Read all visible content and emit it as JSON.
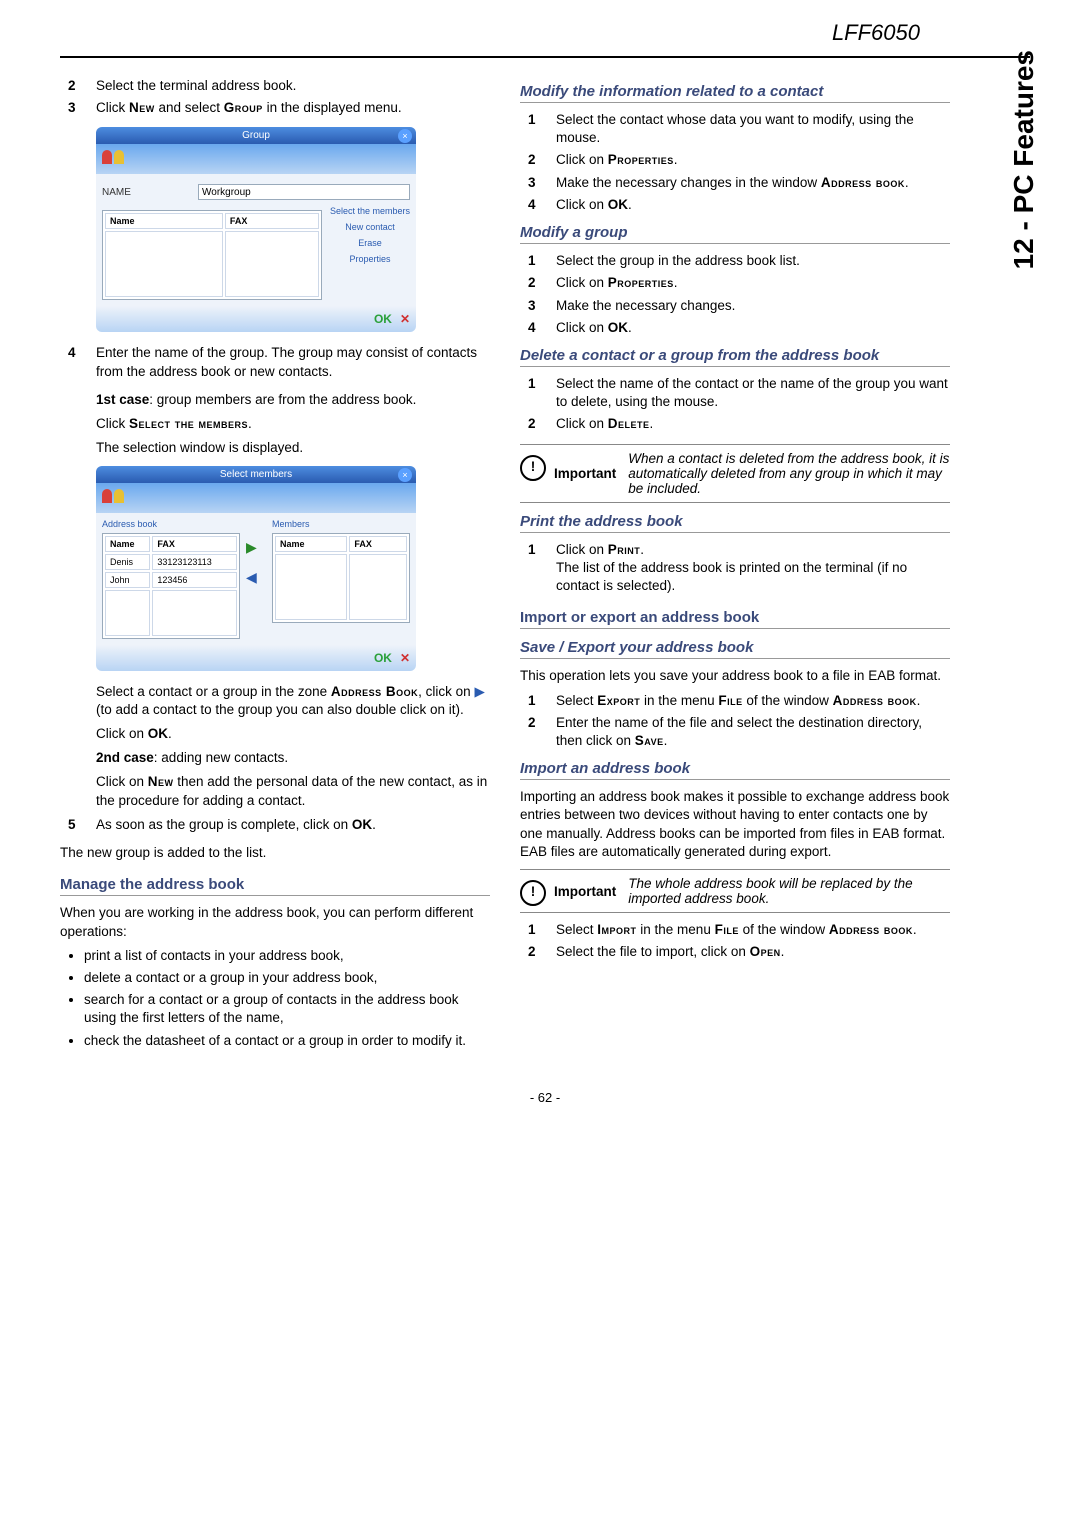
{
  "header": {
    "model": "LFF6050"
  },
  "sidebar": {
    "tab": "12 - PC Features"
  },
  "footer": {
    "page": "- 62 -"
  },
  "left": {
    "steps_top": [
      "Select the terminal address book.",
      "Click NEW and select GROUP in the displayed menu."
    ],
    "dialog1": {
      "title": "Group",
      "name_label": "NAME",
      "name_value": "Workgroup",
      "col_name": "Name",
      "col_fax": "FAX",
      "btn_select": "Select the members",
      "btn_new": "New contact",
      "btn_erase": "Erase",
      "btn_props": "Properties",
      "ok": "OK",
      "x": "✕"
    },
    "step4": "Enter the name of the group. The group may consist of contacts from the address book or new contacts.",
    "case1_a": "1st case: group members are from the address book.",
    "case1_b": "Click SELECT THE MEMBERS.",
    "case1_c": "The selection window is displayed.",
    "dialog2": {
      "title": "Select members",
      "abook": "Address book",
      "members": "Members",
      "col_name": "Name",
      "col_fax": "FAX",
      "row1_name": "Denis",
      "row1_fax": "33123123113",
      "row2_name": "John",
      "row2_fax": "123456",
      "ok": "OK",
      "x": "✕"
    },
    "case1_d1": "Select a contact or a group in the zone ADDRESS BOOK, click on ",
    "case1_d2": " (to add a contact to the group you can also double click on it).",
    "case1_e": "Click on OK.",
    "case2_a": "2nd case: adding new contacts.",
    "case2_b": "Click on NEW then add the personal data of the new contact, as in the procedure for adding a contact.",
    "step5": "As soon as the group is complete, click on OK.",
    "after5": "The new group is added to the list.",
    "manage_h": "Manage the address book",
    "manage_p": "When you are working in the address book, you can perform different operations:",
    "bullets": [
      "print a list of contacts in your address book,",
      "delete a contact or a group in your address book,",
      "search for a contact or a group of contacts in the address book using the first letters of the name,",
      "check the datasheet of a contact or a group in order to modify it."
    ]
  },
  "right": {
    "modinfo_h": "Modify the information related to a contact",
    "modinfo_steps": [
      "Select the contact whose data you want to modify, using the mouse.",
      "Click on PROPERTIES.",
      "Make the necessary changes in the window ADDRESS BOOK.",
      "Click on OK."
    ],
    "modgrp_h": "Modify a group",
    "modgrp_steps": [
      "Select the group in the address book list.",
      "Click on PROPERTIES.",
      "Make the necessary changes.",
      "Click on OK."
    ],
    "del_h": "Delete a contact or a group from the address book",
    "del_steps": [
      "Select the name of the contact or the name of the group you want to delete, using the mouse.",
      "Click on DELETE."
    ],
    "note1_label": "Important",
    "note1_text": "When a contact is deleted from the address book, it is automatically deleted from any group in which it may be included.",
    "print_h": "Print the address book",
    "print_step1a": "Click on PRINT.",
    "print_step1b": "The list of the address book is printed on the terminal (if no contact is selected).",
    "impexp_h": "Import or export an address book",
    "save_h": "Save / Export your address book",
    "save_p": "This operation lets you save your address book to a file in EAB format.",
    "save_steps": [
      "Select EXPORT in the menu FILE of the window ADDRESS BOOK.",
      "Enter the name of the file and select the destination directory, then click on SAVE."
    ],
    "imp_h": "Import an address book",
    "imp_p": "Importing an address book makes it possible to exchange address book entries between two devices without having to enter contacts one by one manually. Address books can be imported from files in EAB format. EAB files are automatically generated during export.",
    "note2_label": "Important",
    "note2_text": "The whole address book will be replaced by the imported address book.",
    "imp_steps": [
      "Select IMPORT in the menu FILE of the window ADDRESS BOOK.",
      "Select the file to import, click on OPEN."
    ]
  }
}
